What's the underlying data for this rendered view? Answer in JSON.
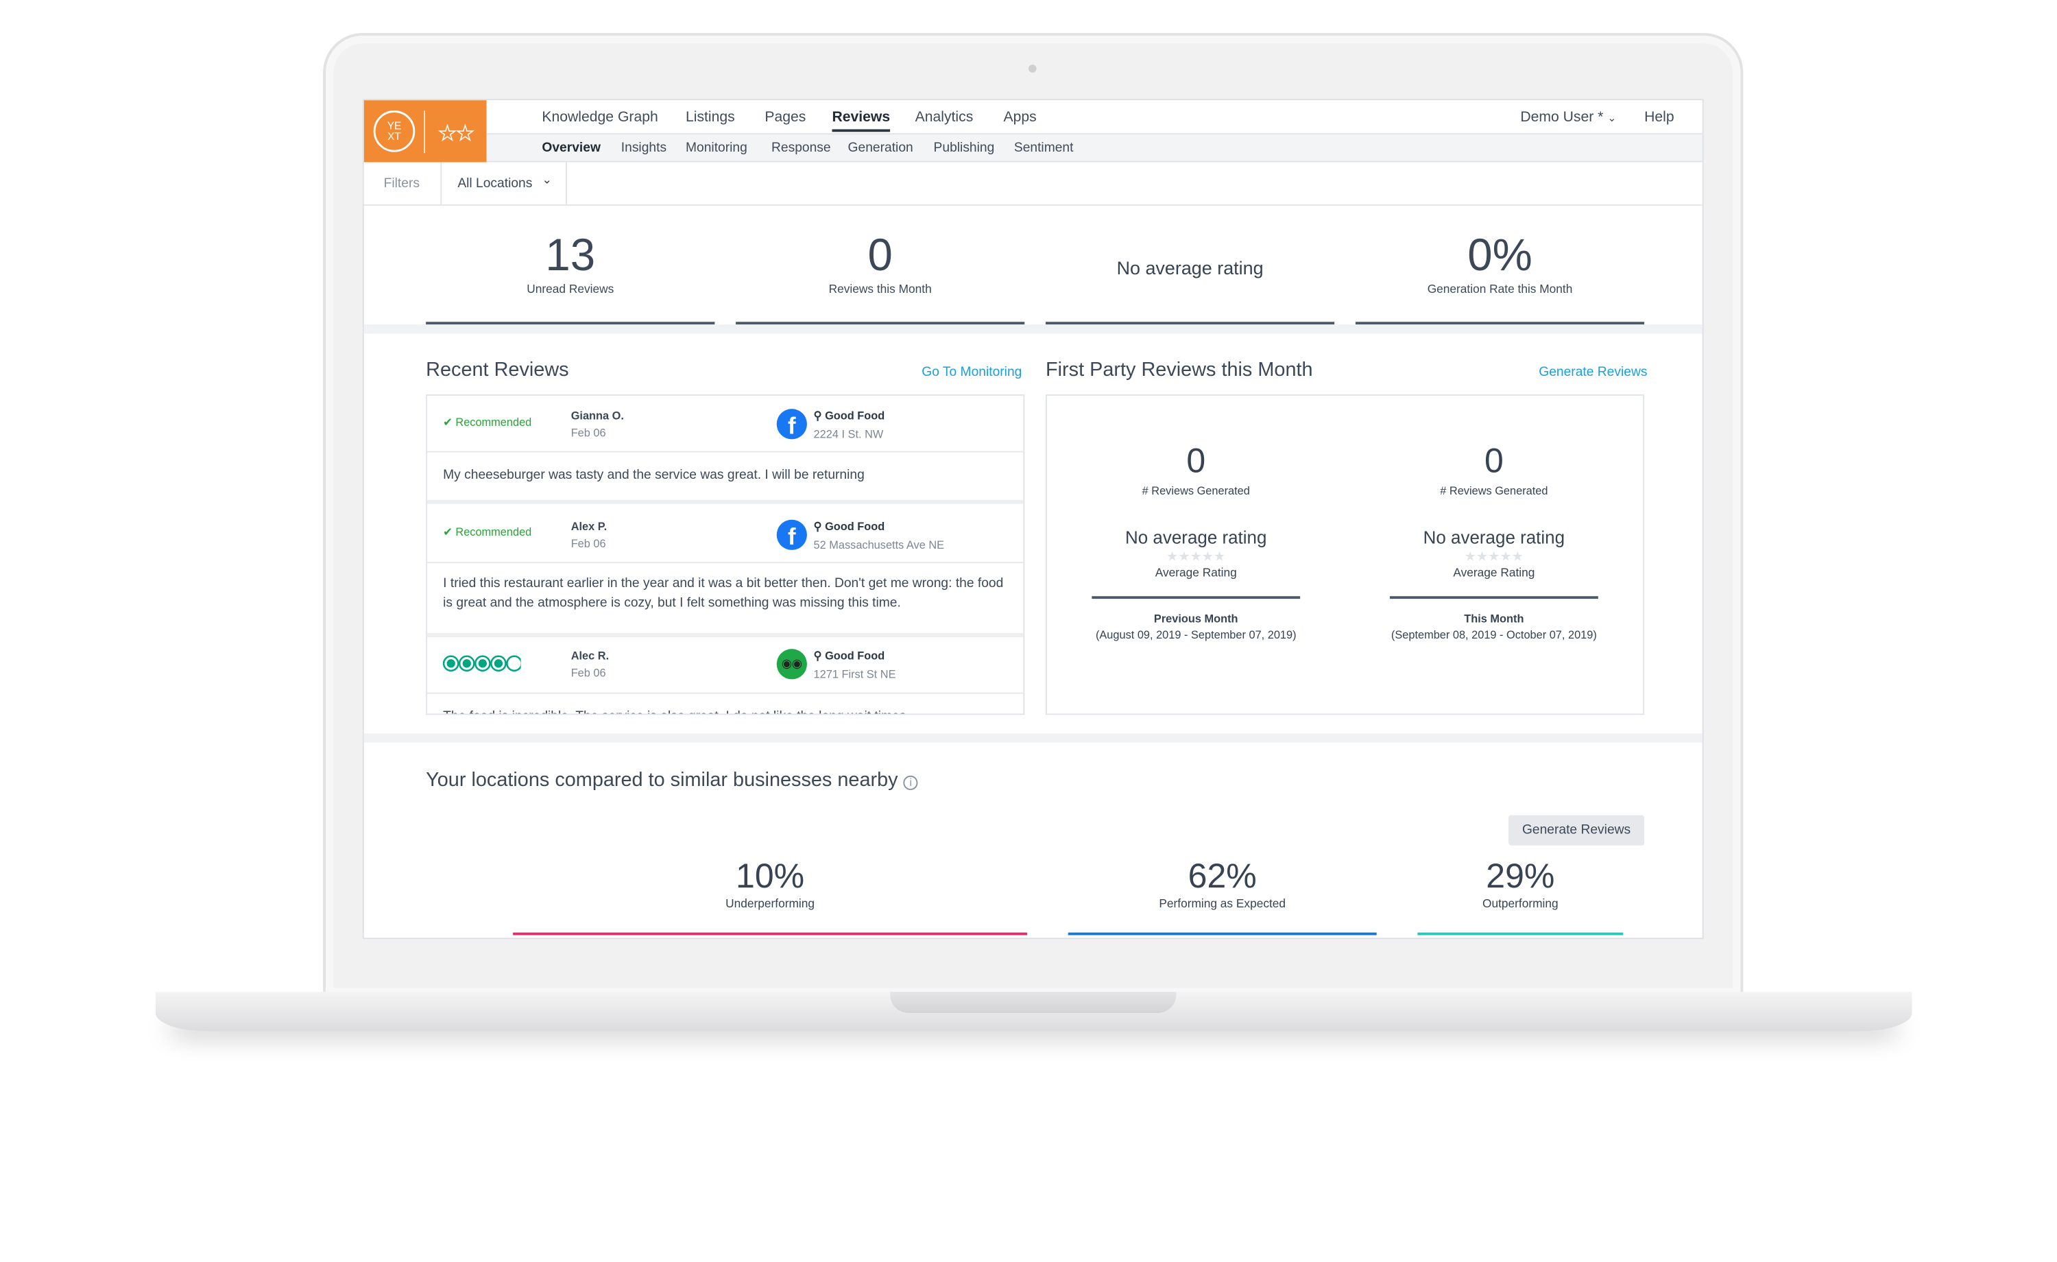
{
  "app": {
    "logo_text": "YEXT",
    "accent": "#f28a33"
  },
  "nav": {
    "items": [
      {
        "label": "Knowledge Graph"
      },
      {
        "label": "Listings"
      },
      {
        "label": "Pages"
      },
      {
        "label": "Reviews",
        "active": true
      },
      {
        "label": "Analytics"
      },
      {
        "label": "Apps"
      }
    ],
    "user": "Demo User *",
    "help": "Help"
  },
  "subnav": {
    "items": [
      {
        "label": "Overview",
        "active": true
      },
      {
        "label": "Insights"
      },
      {
        "label": "Monitoring"
      },
      {
        "label": "Response"
      },
      {
        "label": "Generation"
      },
      {
        "label": "Publishing"
      },
      {
        "label": "Sentiment"
      }
    ]
  },
  "filters": {
    "label": "Filters",
    "location": "All Locations"
  },
  "stats": [
    {
      "value": "13",
      "label": "Unread Reviews"
    },
    {
      "value": "0",
      "label": "Reviews this Month"
    },
    {
      "value": "No average rating",
      "label": ""
    },
    {
      "value": "0%",
      "label": "Generation Rate this Month"
    }
  ],
  "recent": {
    "title": "Recent Reviews",
    "link": "Go To Monitoring",
    "reviews": [
      {
        "rating": "Recommended",
        "name": "Gianna O.",
        "date": "Feb 06",
        "source": "facebook",
        "business": "Good Food",
        "address": "2224 I St. NW",
        "text": "My cheeseburger was tasty and the service was great. I will be returning"
      },
      {
        "rating": "Recommended",
        "name": "Alex P.",
        "date": "Feb 06",
        "source": "facebook",
        "business": "Good Food",
        "address": "52 Massachusetts Ave NE",
        "text": "I tried this restaurant earlier in the year and it was a bit better then. Don't get me wrong: the food is great and the atmosphere is cozy, but I felt something was missing this time."
      },
      {
        "rating_bubbles": 4,
        "rating_max": 5,
        "name": "Alec R.",
        "date": "Feb 06",
        "source": "tripadvisor",
        "business": "Good Food",
        "address": "1271 First St NE",
        "text": "The food is incredible. The service is also great. I do not like the long wait times."
      }
    ]
  },
  "first_party": {
    "title": "First Party Reviews this Month",
    "link": "Generate Reviews",
    "columns": [
      {
        "count": "0",
        "count_label": "# Reviews Generated",
        "rating": "No average rating",
        "stars": 0,
        "rating_label": "Average Rating",
        "period": "Previous Month",
        "range": "(August 09, 2019 - September 07, 2019)"
      },
      {
        "count": "0",
        "count_label": "# Reviews Generated",
        "rating": "No average rating",
        "stars": 0,
        "rating_label": "Average Rating",
        "period": "This Month",
        "range": "(September 08, 2019 - October 07, 2019)"
      }
    ]
  },
  "compare": {
    "title": "Your locations compared to similar businesses nearby",
    "button": "Generate Reviews",
    "items": [
      {
        "value": "10%",
        "label": "Underperforming",
        "percent": 10,
        "color": "#d9336b"
      },
      {
        "value": "62%",
        "label": "Performing as Expected",
        "percent": 62,
        "color": "#1f77c7"
      },
      {
        "value": "29%",
        "label": "Outperforming",
        "percent": 29,
        "color": "#2ec4b6"
      }
    ]
  }
}
